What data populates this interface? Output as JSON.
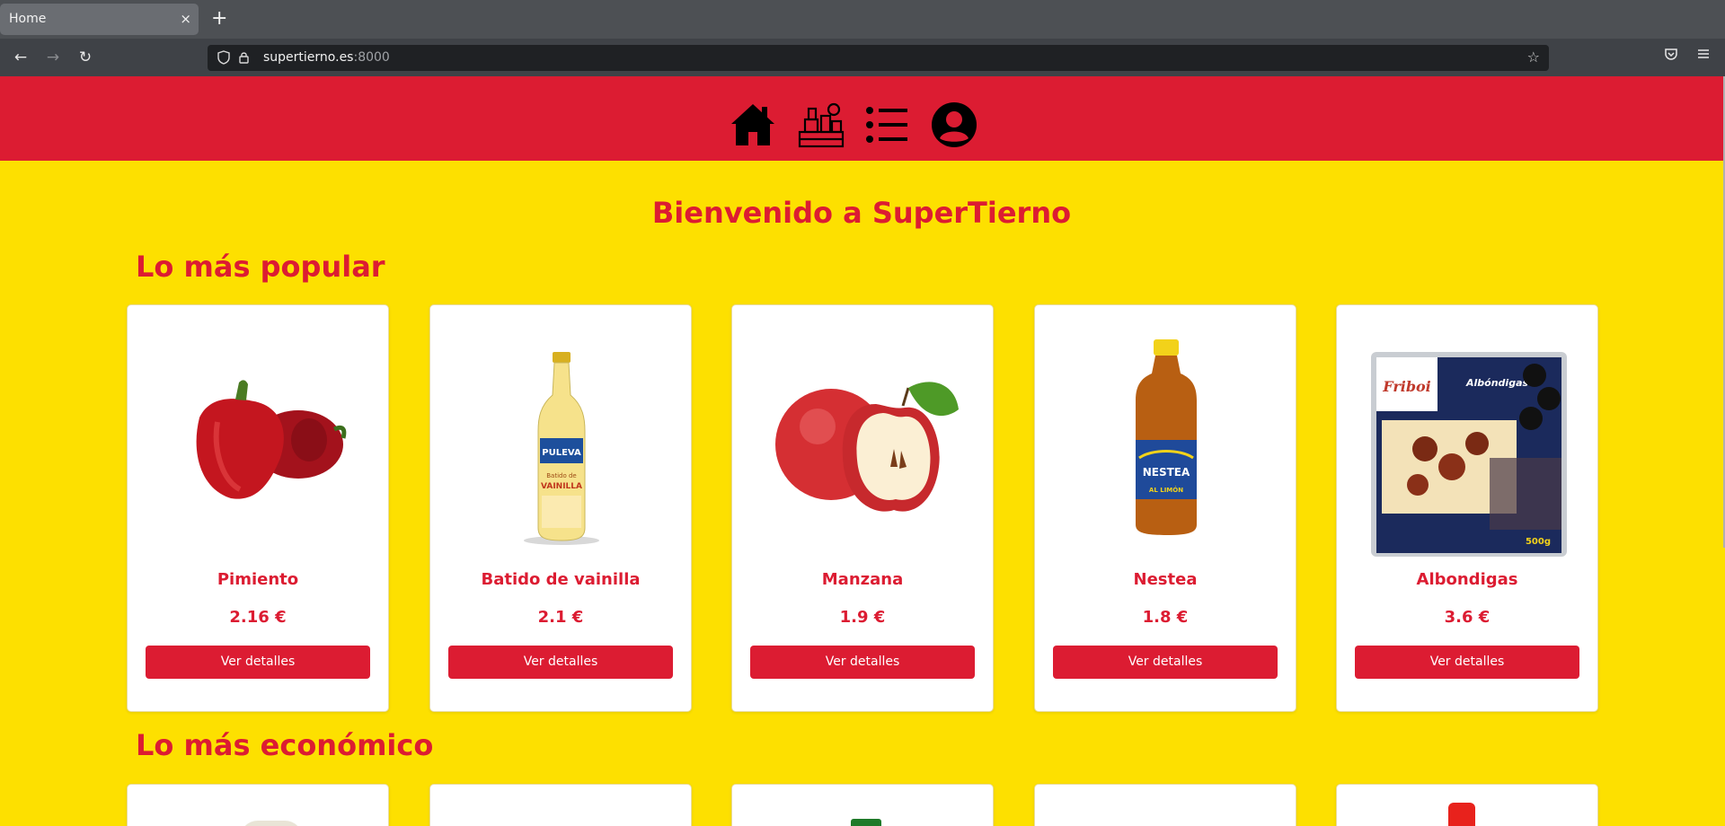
{
  "browser": {
    "tab_title": "Home",
    "tab_close": "×",
    "new_tab": "+",
    "url_host": "supertierno.es",
    "url_port": ":8000"
  },
  "header": {
    "icons": [
      "home-icon",
      "groceries-icon",
      "list-icon",
      "user-icon"
    ]
  },
  "welcome": "Bienvenido a SuperTierno",
  "sections": [
    {
      "title": "Lo más popular",
      "products": [
        {
          "name": "Pimiento",
          "price": "2.16 €",
          "button": "Ver detalles"
        },
        {
          "name": "Batido de vainilla",
          "price": "2.1 €",
          "button": "Ver detalles"
        },
        {
          "name": "Manzana",
          "price": "1.9 €",
          "button": "Ver detalles"
        },
        {
          "name": "Nestea",
          "price": "1.8 €",
          "button": "Ver detalles"
        },
        {
          "name": "Albondigas",
          "price": "3.6 €",
          "button": "Ver detalles"
        }
      ]
    },
    {
      "title": "Lo más económico"
    }
  ],
  "product_labels": {
    "puleva_brand": "PULEVA",
    "puleva_line1": "Batido de",
    "puleva_line2": "VAINILLA",
    "nestea_brand": "NESTEA",
    "nestea_flavor": "AL LIMÓN",
    "friboi_brand": "Friboi",
    "friboi_product": "Albóndigas",
    "friboi_weight": "500g"
  },
  "colors": {
    "brand_red": "#dc1c32",
    "background_yellow": "#fde000"
  }
}
